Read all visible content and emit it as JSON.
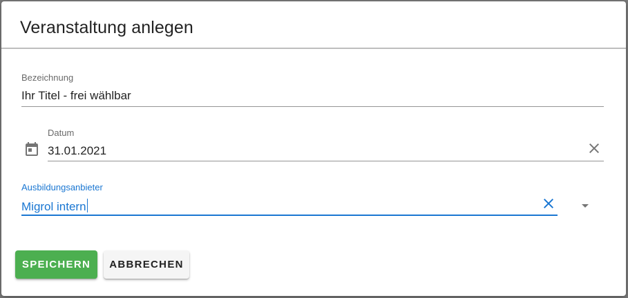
{
  "dialog": {
    "title": "Veranstaltung anlegen"
  },
  "fields": {
    "title": {
      "label": "Bezeichnung",
      "value": "Ihr Titel - frei wählbar"
    },
    "date": {
      "label": "Datum",
      "value": "31.01.2021",
      "icon": "calendar-icon"
    },
    "provider": {
      "label": "Ausbildungsanbieter",
      "value": "Migrol intern",
      "focused": true
    }
  },
  "buttons": {
    "save_label": "SPEICHERN",
    "cancel_label": "ABBRECHEN"
  },
  "colors": {
    "accent": "#1976d2",
    "save": "#4caf50"
  }
}
